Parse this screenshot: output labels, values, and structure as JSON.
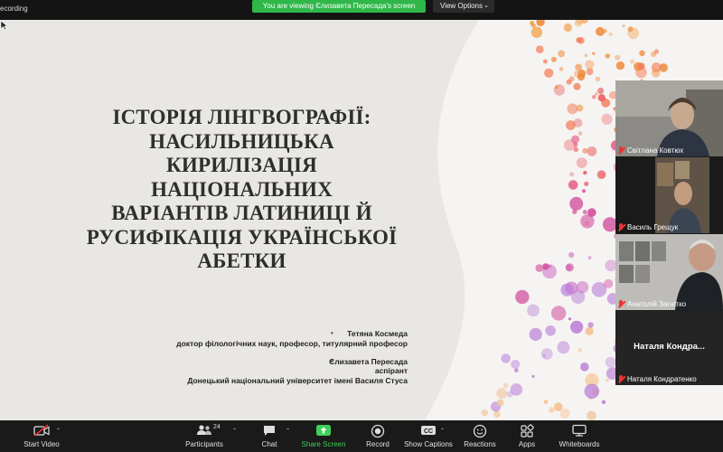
{
  "topbar": {
    "recording": "ecording",
    "viewing_banner": "You are viewing Єлизавета Пересада's screen",
    "view_options": "View Options"
  },
  "slide": {
    "title_lines": [
      "ІСТОРІЯ ЛІНГВОГРАФІЇ:",
      "НАСИЛЬНИЦЬКА",
      "КИРИЛІЗАЦІЯ",
      "НАЦІОНАЛЬНИХ",
      "ВАРІАНТІВ ЛАТИНИЦІ Й",
      "РУСИФІКАЦІЯ УКРАЇНСЬКОЇ",
      "АБЕТКИ"
    ],
    "author1_name": "Тетяна Космеда",
    "author1_title": "доктор філологічних наук, професор, титулярний професор",
    "author2_name": "Єлизавета Пересада",
    "author2_title": "аспірант",
    "author2_org": "Донецький національний університет імені Василя Стуса",
    "bullet_char": "•"
  },
  "participants": [
    {
      "name": "Світлана Ковтюх",
      "muted": true
    },
    {
      "name": "Василь Грещук",
      "muted": true
    },
    {
      "name": "Анатолій Загнітко",
      "muted": true
    },
    {
      "name": "Наталя Кондратенко",
      "display": "Наталя  Кондра...",
      "muted": true
    }
  ],
  "toolbar": {
    "start_video": "Start Video",
    "participants": "Participants",
    "participants_count": "24",
    "chat": "Chat",
    "share_screen": "Share Screen",
    "record": "Record",
    "show_captions": "Show Captions",
    "reactions": "Reactions",
    "apps": "Apps",
    "whiteboards": "Whiteboards"
  },
  "colors": {
    "share_green": "#2fb74a",
    "toolbar_bg": "#1a1a1a",
    "slide_bg": "#e9e7e4",
    "mute_red": "#e33333"
  }
}
